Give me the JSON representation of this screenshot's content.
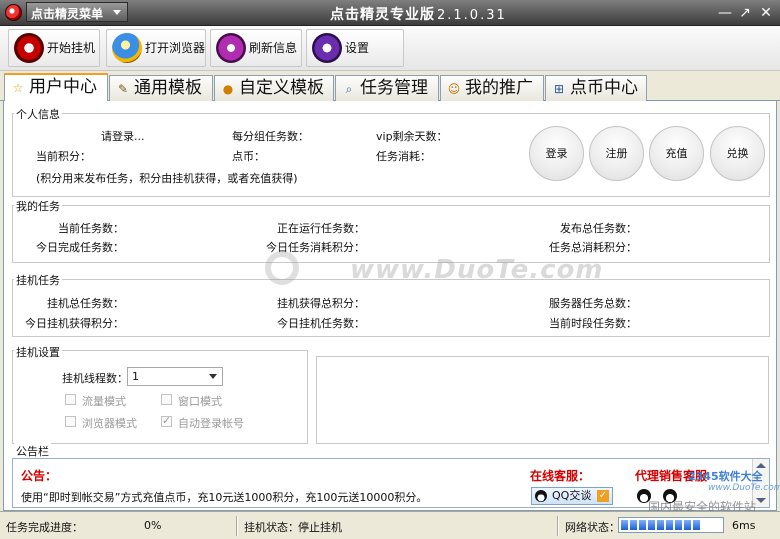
{
  "titlebar": {
    "menu_label": "点击精灵菜单",
    "title": "点击精灵专业版",
    "version": "2.1.0.31",
    "minimize": "—",
    "maximize": "↗",
    "close": "✕"
  },
  "toolbar": {
    "start_label": "开始挂机",
    "browser_label": "打开浏览器",
    "refresh_label": "刷新信息",
    "settings_label": "设置"
  },
  "tabs": [
    {
      "label": "用户中心",
      "icon": "star-icon"
    },
    {
      "label": "通用模板",
      "icon": "wand-icon"
    },
    {
      "label": "自定义模板",
      "icon": "palette-icon"
    },
    {
      "label": "任务管理",
      "icon": "doc-search-icon"
    },
    {
      "label": "我的推广",
      "icon": "people-icon"
    },
    {
      "label": "点币中心",
      "icon": "cart-icon"
    }
  ],
  "personal": {
    "title": "个人信息",
    "login_prompt": "请登录...",
    "points_label": "当前积分：",
    "group_tasks_label": "每分组任务数：",
    "coins_label": "点币：",
    "vip_days_label": "vip剩余天数：",
    "task_consume_label": "任务消耗：",
    "note": "(积分用来发布任务，积分由挂机获得，或者充值获得)",
    "btn_login": "登录",
    "btn_register": "注册",
    "btn_recharge": "充值",
    "btn_exchange": "兑换"
  },
  "my_tasks": {
    "title": "我的任务",
    "current_tasks": "当前任务数：",
    "today_completed": "今日完成任务数：",
    "running_tasks": "正在运行任务数：",
    "today_consumed_points": "今日任务消耗积分：",
    "published_total": "发布总任务数：",
    "total_consumed_points": "任务总消耗积分："
  },
  "hang_tasks": {
    "title": "挂机任务",
    "total_tasks": "挂机总任务数：",
    "today_points": "今日挂机获得积分：",
    "earned_total_points": "挂机获得总积分：",
    "today_hang_tasks": "今日挂机任务数：",
    "server_total": "服务器任务总数：",
    "current_period": "当前时段任务数："
  },
  "hang_settings": {
    "title": "挂机设置",
    "threads_label": "挂机线程数：",
    "threads_value": "1",
    "traffic_mode": "流量模式",
    "window_mode": "窗口模式",
    "browser_mode": "浏览器模式",
    "auto_login": "自动登录帐号"
  },
  "notice": {
    "title": "公告栏",
    "heading": "公告：",
    "text": "使用“即时到帐交易”方式充值点币，充10元送1000积分，充100元送10000积分。",
    "online_cs": "在线客服：",
    "qq_label": "QQ交谈",
    "agent_cs": "代理销售客服"
  },
  "status": {
    "progress_label": "任务完成进度：",
    "progress_value": "0%",
    "hang_state_label": "挂机状态：",
    "hang_state_value": "停止挂机",
    "net_label": "网络状态：",
    "net_latency": "6ms",
    "net_level": 0.8
  },
  "watermarks": {
    "site": "www.DuoTe.com",
    "corner_brand": "2345软件大全",
    "corner_url": "www.DuoTe.com",
    "corner_slogan": "国内最安全的软件站"
  }
}
